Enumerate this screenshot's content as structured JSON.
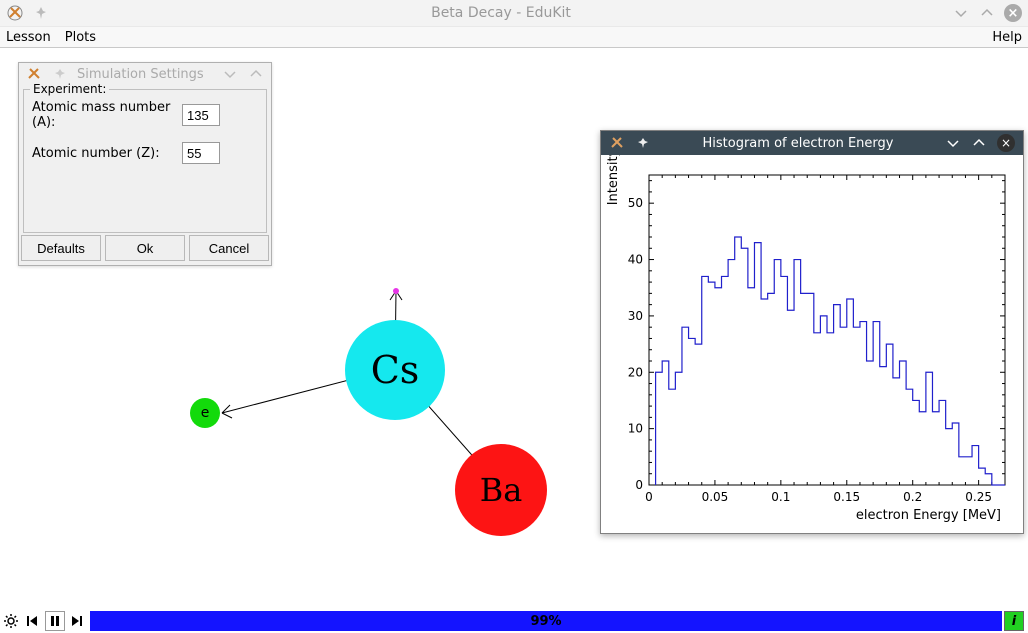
{
  "window": {
    "title": "Beta Decay - EduKit"
  },
  "menubar": {
    "lesson": "Lesson",
    "plots": "Plots",
    "help": "Help"
  },
  "settings": {
    "title": "Simulation Settings",
    "legend": "Experiment:",
    "mass_label": "Atomic mass number (A):",
    "mass_value": "135",
    "z_label": "Atomic number (Z):",
    "z_value": "55",
    "defaults": "Defaults",
    "ok": "Ok",
    "cancel": "Cancel"
  },
  "simulation": {
    "parent_label": "Cs",
    "daughter_label": "Ba",
    "electron_label": "e"
  },
  "histogram_window": {
    "title": "Histogram of electron Energy"
  },
  "chart_data": {
    "type": "histogram-step",
    "title": "",
    "xlabel": "electron Energy [MeV]",
    "ylabel": "Intensity",
    "xlim": [
      0,
      0.27
    ],
    "ylim": [
      0,
      55
    ],
    "xticks": [
      0,
      0.05,
      0.1,
      0.15,
      0.2,
      0.25
    ],
    "yticks": [
      0,
      10,
      20,
      30,
      40,
      50
    ],
    "bin_width": 0.005,
    "bin_left_edges": [
      0.005,
      0.01,
      0.015,
      0.02,
      0.025,
      0.03,
      0.035,
      0.04,
      0.045,
      0.05,
      0.055,
      0.06,
      0.065,
      0.07,
      0.075,
      0.08,
      0.085,
      0.09,
      0.095,
      0.1,
      0.105,
      0.11,
      0.115,
      0.12,
      0.125,
      0.13,
      0.135,
      0.14,
      0.145,
      0.15,
      0.155,
      0.16,
      0.165,
      0.17,
      0.175,
      0.18,
      0.185,
      0.19,
      0.195,
      0.2,
      0.205,
      0.21,
      0.215,
      0.22,
      0.225,
      0.23,
      0.235,
      0.24,
      0.245,
      0.25,
      0.255,
      0.26,
      0.265
    ],
    "counts": [
      20,
      22,
      17,
      20,
      28,
      26,
      25,
      37,
      36,
      35,
      37,
      40,
      44,
      42,
      35,
      43,
      33,
      34,
      40,
      37,
      31,
      40,
      34,
      34,
      27,
      30,
      27,
      32,
      28,
      33,
      28,
      29,
      22,
      29,
      21,
      25,
      19,
      22,
      17,
      15,
      13,
      20,
      13,
      15,
      10,
      11,
      5,
      5,
      7,
      3,
      2,
      0,
      0
    ]
  },
  "bottombar": {
    "progress_text": "99%"
  }
}
